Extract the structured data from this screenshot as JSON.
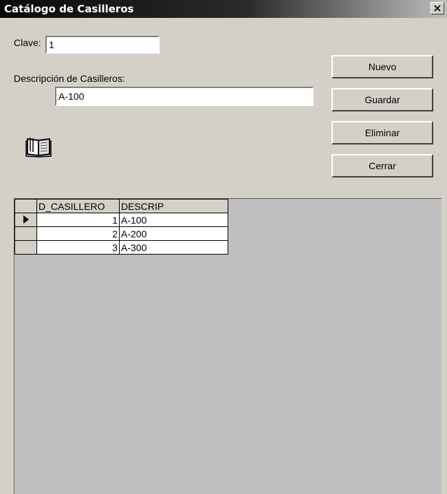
{
  "window": {
    "title": "Catálogo de Casilleros"
  },
  "form": {
    "clave_label": "Clave:",
    "clave_value": "1",
    "descripcion_label": "Descripción de Casilleros:",
    "descripcion_value": "A-100"
  },
  "buttons": {
    "nuevo": "Nuevo",
    "guardar": "Guardar",
    "eliminar": "Eliminar",
    "cerrar": "Cerrar"
  },
  "grid": {
    "columns": [
      "D_CASILLERO",
      "DESCRIP"
    ],
    "rows": [
      {
        "id": "1",
        "descrip": "A-100",
        "current": true
      },
      {
        "id": "2",
        "descrip": "A-200",
        "current": false
      },
      {
        "id": "3",
        "descrip": "A-300",
        "current": false
      }
    ]
  },
  "icons": {
    "close": "close-icon",
    "book": "book-icon",
    "current_row": "row-pointer-icon"
  }
}
